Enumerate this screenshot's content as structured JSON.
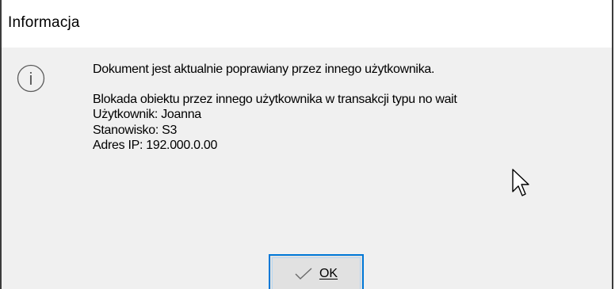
{
  "window": {
    "title": "Informacja"
  },
  "icon": {
    "type": "info-icon",
    "glyph": "i",
    "color": "#5a5a5a"
  },
  "message": {
    "headline": "Dokument jest aktualnie poprawiany przez innego użytkownika.",
    "details": [
      "Blokada obiektu przez innego użytkownika w transakcji typu no wait",
      "Użytkownik: Joanna",
      "Stanowisko: S3",
      "Adres IP: 192.000.0.00"
    ]
  },
  "ok_button": {
    "label": "OK",
    "icon": "check-icon",
    "border_color": "#0078d7"
  },
  "colors": {
    "dialog_bg": "#f0f0f0",
    "titlebar_bg": "#ffffff",
    "button_bg": "#e1e1e1"
  }
}
